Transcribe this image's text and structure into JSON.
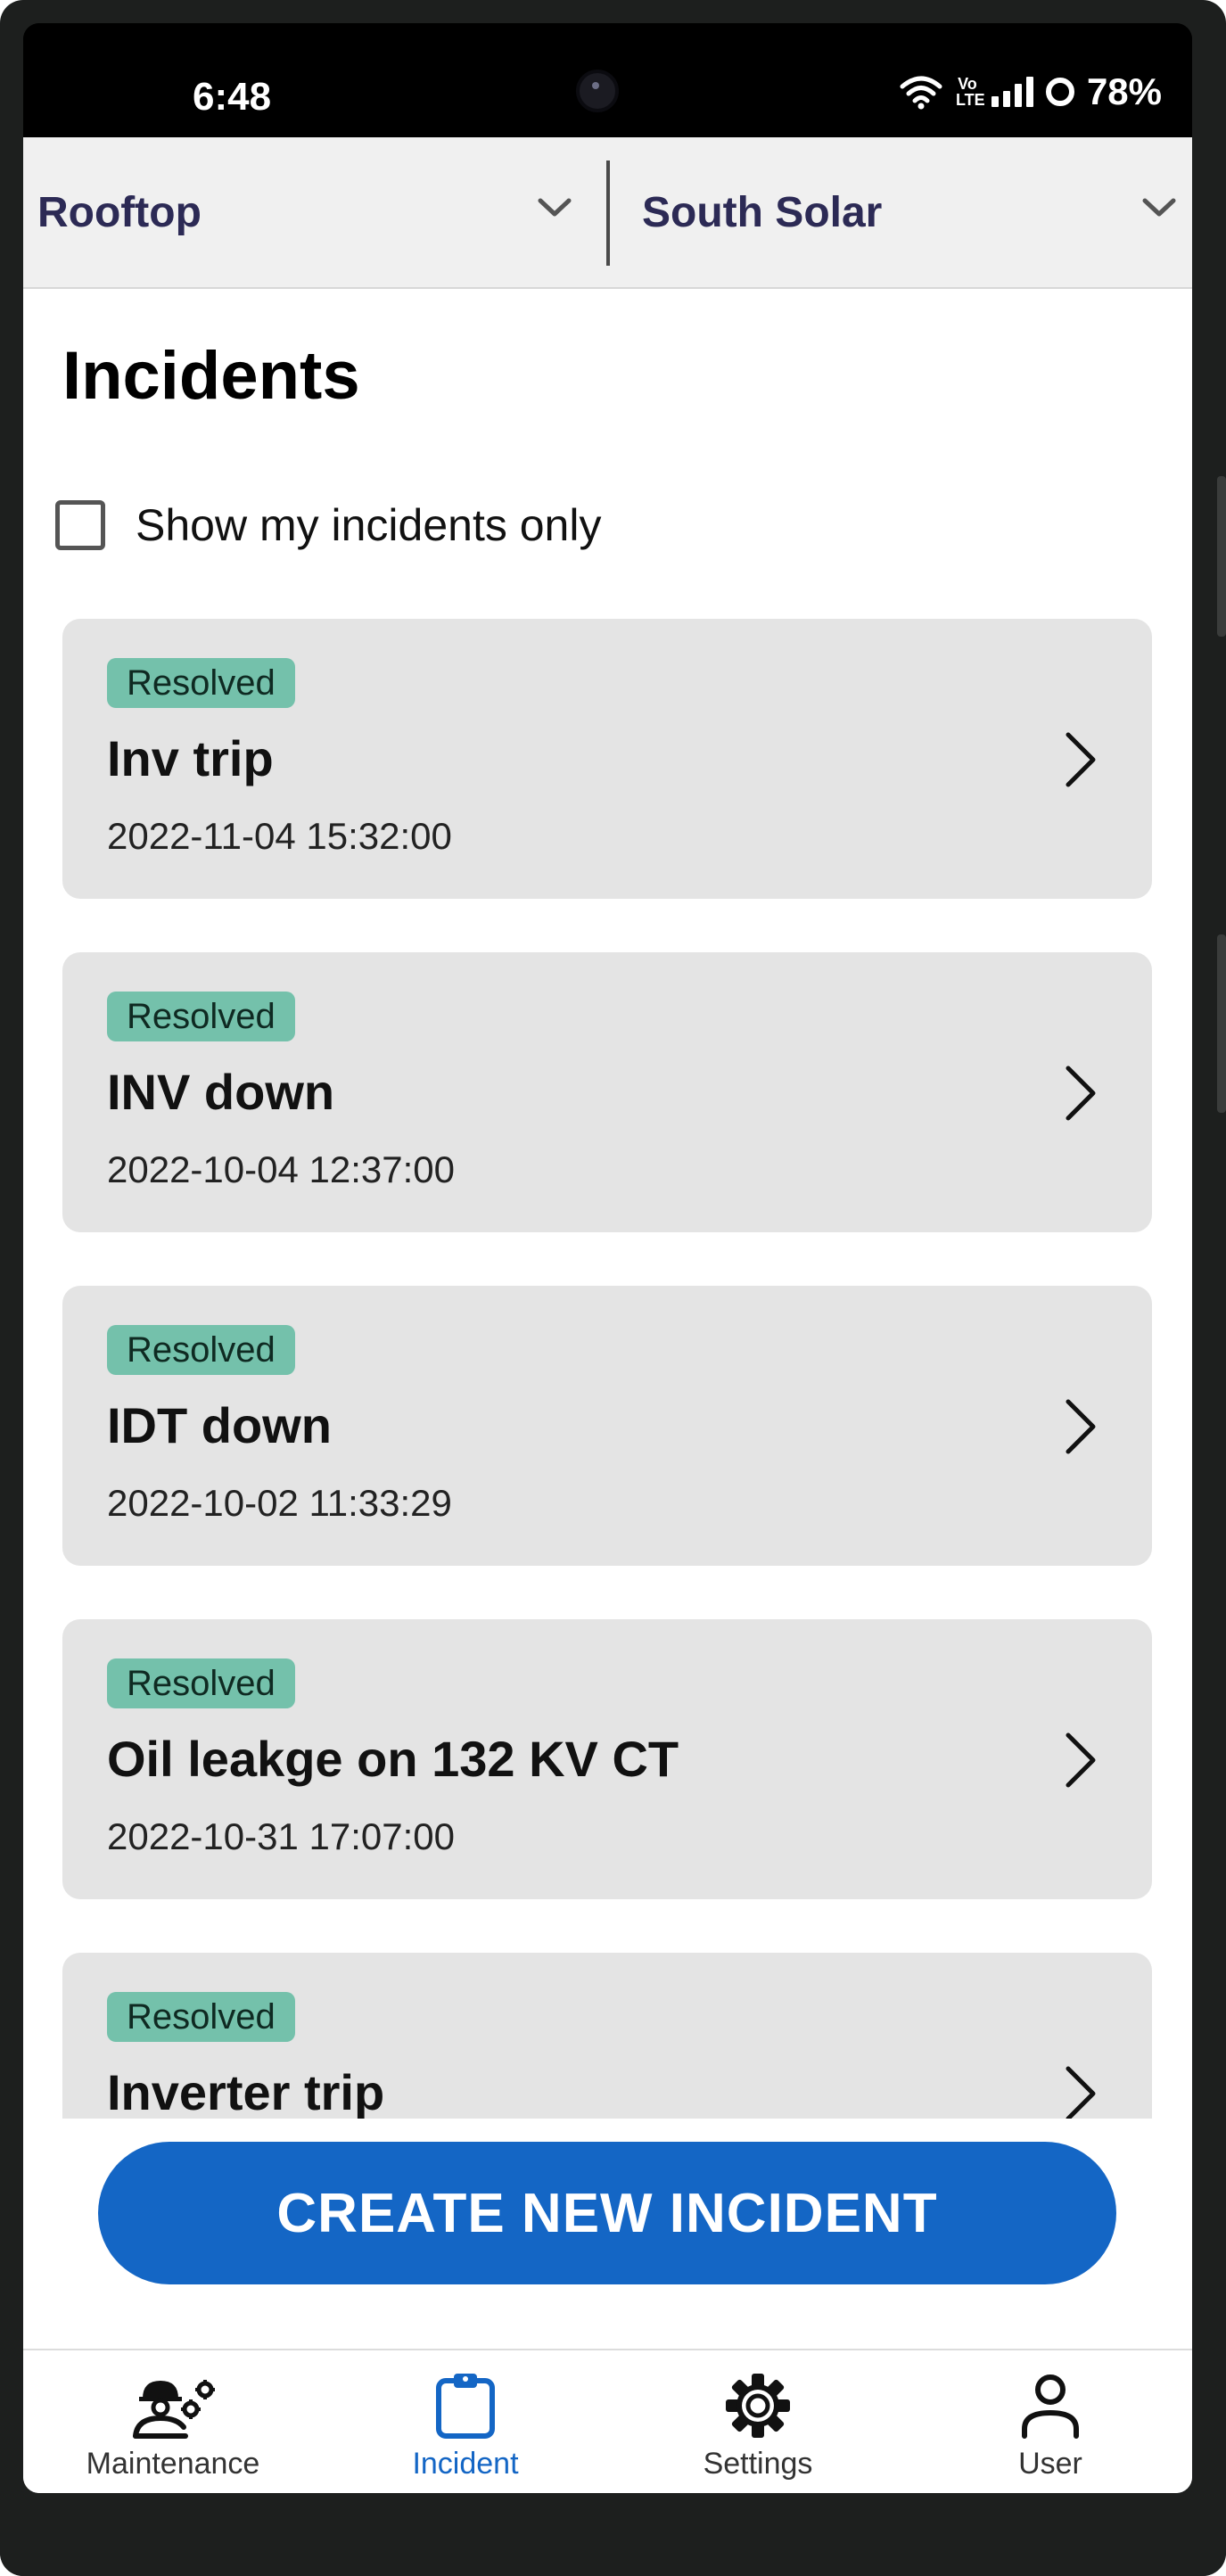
{
  "status_bar": {
    "time": "6:48",
    "network_label": "Vo LTE",
    "battery": "78%"
  },
  "selectors": {
    "left": {
      "value": "Rooftop",
      "icon": "chevron-down-icon"
    },
    "right": {
      "value": "South Solar",
      "icon": "chevron-down-icon"
    }
  },
  "page": {
    "title": "Incidents",
    "filter_label": "Show my incidents only",
    "filter_checked": false
  },
  "incidents": [
    {
      "status": "Resolved",
      "title": "Inv trip",
      "date": "2022-11-04 15:32:00"
    },
    {
      "status": "Resolved",
      "title": "INV down",
      "date": "2022-10-04 12:37:00"
    },
    {
      "status": "Resolved",
      "title": "IDT down",
      "date": "2022-10-02 11:33:29"
    },
    {
      "status": "Resolved",
      "title": "Oil leakge on 132 KV CT",
      "date": "2022-10-31 17:07:00"
    },
    {
      "status": "Resolved",
      "title": "Inverter trip",
      "date": ""
    }
  ],
  "cta": {
    "label": "CREATE NEW INCIDENT"
  },
  "bottom_nav": [
    {
      "label": "Maintenance",
      "icon": "maintenance-worker-icon",
      "active": false
    },
    {
      "label": "Incident",
      "icon": "clipboard-icon",
      "active": true
    },
    {
      "label": "Settings",
      "icon": "gear-icon",
      "active": false
    },
    {
      "label": "User",
      "icon": "user-icon",
      "active": false
    }
  ],
  "colors": {
    "accent": "#1466c5",
    "badge": "#74c1ab",
    "card": "#e4e4e4",
    "selector_text": "#2c2a55"
  }
}
